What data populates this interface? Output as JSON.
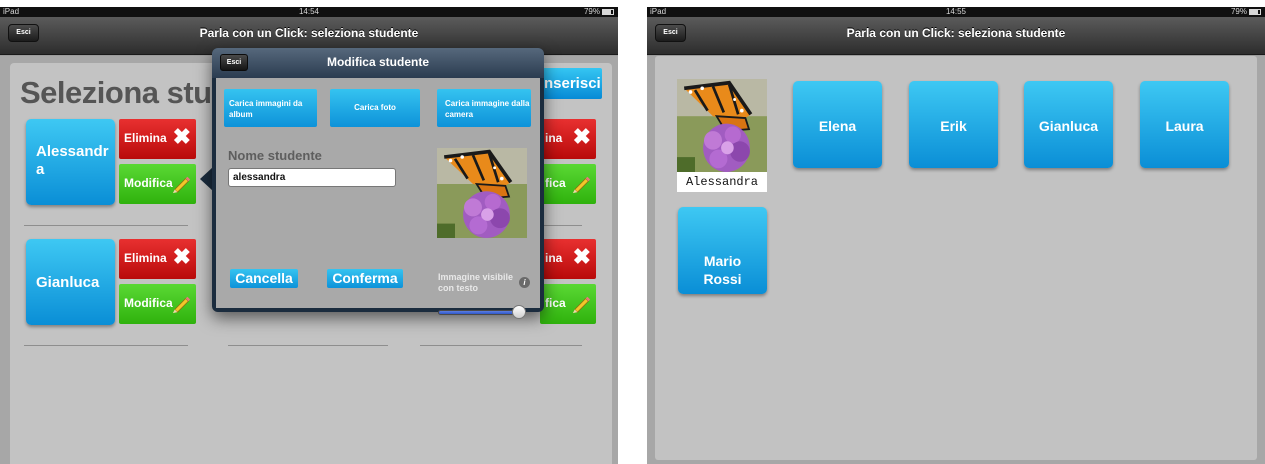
{
  "left_screen": {
    "status": {
      "carrier": "iPad",
      "time": "14:54",
      "battery": "79%"
    },
    "nav": {
      "title": "Parla con un Click: seleziona studente",
      "exit_label": "Esci"
    },
    "heading": "Seleziona stud",
    "insert_button": "nserisci",
    "students": [
      {
        "name": "Alessandr\na",
        "delete_label": "Elimina",
        "edit_label": "Modifica"
      },
      {
        "name": "Gianluca",
        "delete_label": "Elimina",
        "edit_label": "Modifica"
      }
    ],
    "partial_actions": [
      {
        "delete_label": "ina",
        "edit_label": "fica"
      },
      {
        "delete_label": "ina",
        "edit_label": "fica"
      }
    ],
    "popover": {
      "title": "Modifica studente",
      "exit_label": "Esci",
      "buttons": {
        "album": "Carica immagini da album",
        "photo": "Carica foto",
        "camera": "Carica immagine dalla camera"
      },
      "name_label": "Nome studente",
      "name_value": "alessandra",
      "visible_label": "Immagine visibile con testo",
      "info_glyph": "i",
      "slider_value": 1,
      "cancel_label": "Cancella",
      "confirm_label": "Conferma"
    }
  },
  "right_screen": {
    "status": {
      "carrier": "iPad",
      "time": "14:55",
      "battery": "79%"
    },
    "nav": {
      "title": "Parla con un Click: seleziona studente",
      "exit_label": "Esci"
    },
    "photo_student": "Alessandra",
    "students": [
      "Elena",
      "Erik",
      "Gianluca",
      "Laura",
      "Mario\nRossi"
    ]
  },
  "icons": {
    "delete": "x-icon",
    "edit": "pencil-icon",
    "info": "info-icon",
    "photo": "butterfly-photo"
  },
  "colors": {
    "accent_blue": "#0a8ed6",
    "delete_red": "#d21a1a",
    "edit_green": "#3cc014",
    "nav_dark": "#2d2d2d"
  }
}
